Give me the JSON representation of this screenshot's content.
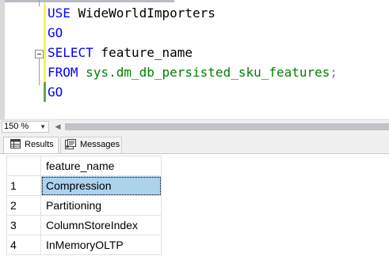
{
  "editor": {
    "lines": [
      {
        "tokens": [
          {
            "cls": "kw",
            "text": "USE"
          },
          {
            "cls": "ident",
            "text": " WideWorldImporters"
          }
        ]
      },
      {
        "tokens": [
          {
            "cls": "kw",
            "text": "GO"
          }
        ]
      },
      {
        "tokens": [
          {
            "cls": "kw",
            "text": "SELECT"
          },
          {
            "cls": "ident",
            "text": " feature_name"
          }
        ]
      },
      {
        "tokens": [
          {
            "cls": "kw",
            "text": "FROM"
          },
          {
            "cls": "ident",
            "text": " "
          },
          {
            "cls": "sys",
            "text": "sys.dm_db_persisted_sku_features"
          },
          {
            "cls": "punc",
            "text": ";"
          }
        ]
      },
      {
        "tokens": [
          {
            "cls": "kw",
            "text": "GO"
          }
        ]
      }
    ],
    "change_bar_colors": [
      "#ffee62",
      "#ffee62",
      "#ffee62",
      "#ffee62",
      "#5fa84d"
    ]
  },
  "zoom": {
    "value": "150 %",
    "dropdown_icon": "chevron-down-icon",
    "scroll_left_icon": "triangle-left-icon"
  },
  "tabs": [
    {
      "label": "Results",
      "icon": "grid-icon",
      "active": true
    },
    {
      "label": "Messages",
      "icon": "messages-icon",
      "active": false
    }
  ],
  "results": {
    "columns": [
      "feature_name"
    ],
    "rows": [
      {
        "num": "1",
        "feature_name": "Compression"
      },
      {
        "num": "2",
        "feature_name": "Partitioning"
      },
      {
        "num": "3",
        "feature_name": "ColumnStoreIndex"
      },
      {
        "num": "4",
        "feature_name": "InMemoryOLTP"
      }
    ],
    "selected_row": 0
  },
  "colors": {
    "keyword": "#0000ff",
    "system_object": "#008000",
    "selection": "#add2ee"
  }
}
